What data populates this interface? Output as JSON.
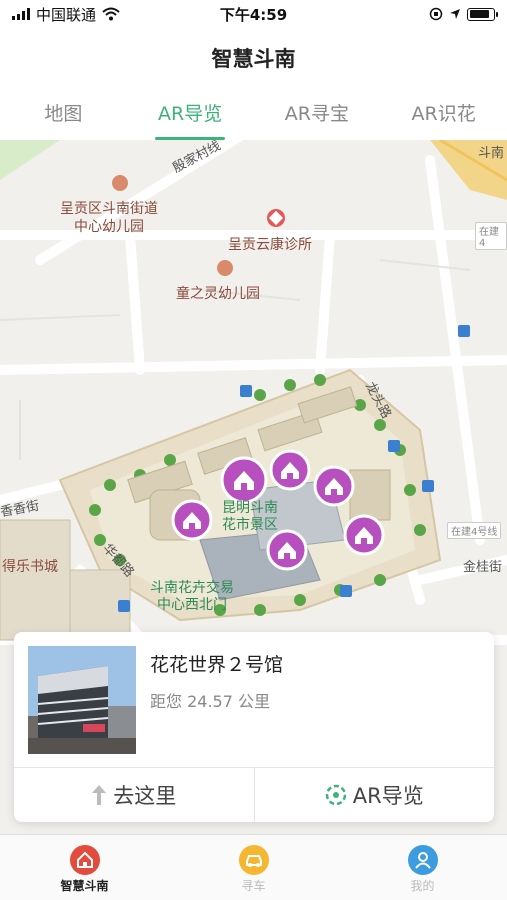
{
  "status": {
    "carrier": "中国联通",
    "time": "下午4:59"
  },
  "header": {
    "title": "智慧斗南"
  },
  "tabs": [
    {
      "label": "地图",
      "active": false
    },
    {
      "label": "AR导览",
      "active": true
    },
    {
      "label": "AR寻宝",
      "active": false
    },
    {
      "label": "AR识花",
      "active": false
    }
  ],
  "map": {
    "pois": {
      "kindergarten1": "呈贡区斗南街道\n中心幼儿园",
      "clinic": "呈贡云康诊所",
      "kindergarten2": "童之灵幼儿园",
      "bookstore": "得乐书城"
    },
    "streets": {
      "yinjia": "殷家村线",
      "longtou": "龙头路",
      "jingui": "金桂街",
      "huadu": "华都路",
      "xiangxin": "香香街",
      "doun": "斗南"
    },
    "area": {
      "scenic": "昆明斗南\n花市景区",
      "market_gate": "斗南花卉交易\n中心西北门"
    },
    "construction_tags": [
      "在建4",
      "在建4号线"
    ]
  },
  "card": {
    "name": "花花世界２号馆",
    "distance": "距您 24.57 公里",
    "goto_label": "去这里",
    "ar_label": "AR导览"
  },
  "nav": [
    {
      "label": "智慧斗南",
      "active": true,
      "icon": "home-icon",
      "color": "#e34b3c"
    },
    {
      "label": "寻车",
      "active": false,
      "icon": "car-icon",
      "color": "#f5b731"
    },
    {
      "label": "我的",
      "active": false,
      "icon": "user-icon",
      "color": "#3d9be0"
    }
  ],
  "colors": {
    "accent": "#3bb37a",
    "marker": "#b84fbf"
  }
}
